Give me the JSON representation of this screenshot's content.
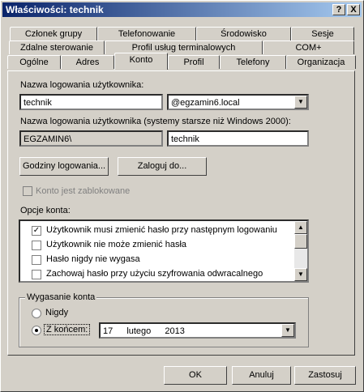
{
  "window": {
    "title": "Właściwości: technik",
    "help_button": "?",
    "close_button": "X"
  },
  "tabs": {
    "row1": [
      "Członek grupy",
      "Telefonowanie",
      "Środowisko",
      "Sesje"
    ],
    "row2": [
      "Zdalne sterowanie",
      "Profil usług terminalowych",
      "COM+"
    ],
    "row3": [
      "Ogólne",
      "Adres",
      "Konto",
      "Profil",
      "Telefony",
      "Organizacja"
    ],
    "active": "Konto"
  },
  "account": {
    "logon_label": "Nazwa logowania użytkownika:",
    "logon_value": "technik",
    "domain_value": "@egzamin6.local",
    "legacy_label": "Nazwa logowania użytkownika (systemy starsze niż Windows 2000):",
    "legacy_domain": "EGZAMIN6\\",
    "legacy_value": "technik",
    "logon_hours_button": "Godziny logowania...",
    "logon_to_button": "Zaloguj do...",
    "locked_label": "Konto jest zablokowane",
    "options_label": "Opcje konta:",
    "options": [
      {
        "label": "Użytkownik musi zmienić hasło przy następnym logowaniu",
        "checked": true
      },
      {
        "label": "Użytkownik nie może zmienić hasła",
        "checked": false
      },
      {
        "label": "Hasło nigdy nie wygasa",
        "checked": false
      },
      {
        "label": "Zachowaj hasło przy użyciu szyfrowania odwracalnego",
        "checked": false
      }
    ],
    "expiry_label": "Wygasanie konta",
    "never_label": "Nigdy",
    "end_label": "Z końcem:",
    "expiry_day": "17",
    "expiry_month": "lutego",
    "expiry_year": "2013"
  },
  "buttons": {
    "ok": "OK",
    "cancel": "Anuluj",
    "apply": "Zastosuj"
  }
}
